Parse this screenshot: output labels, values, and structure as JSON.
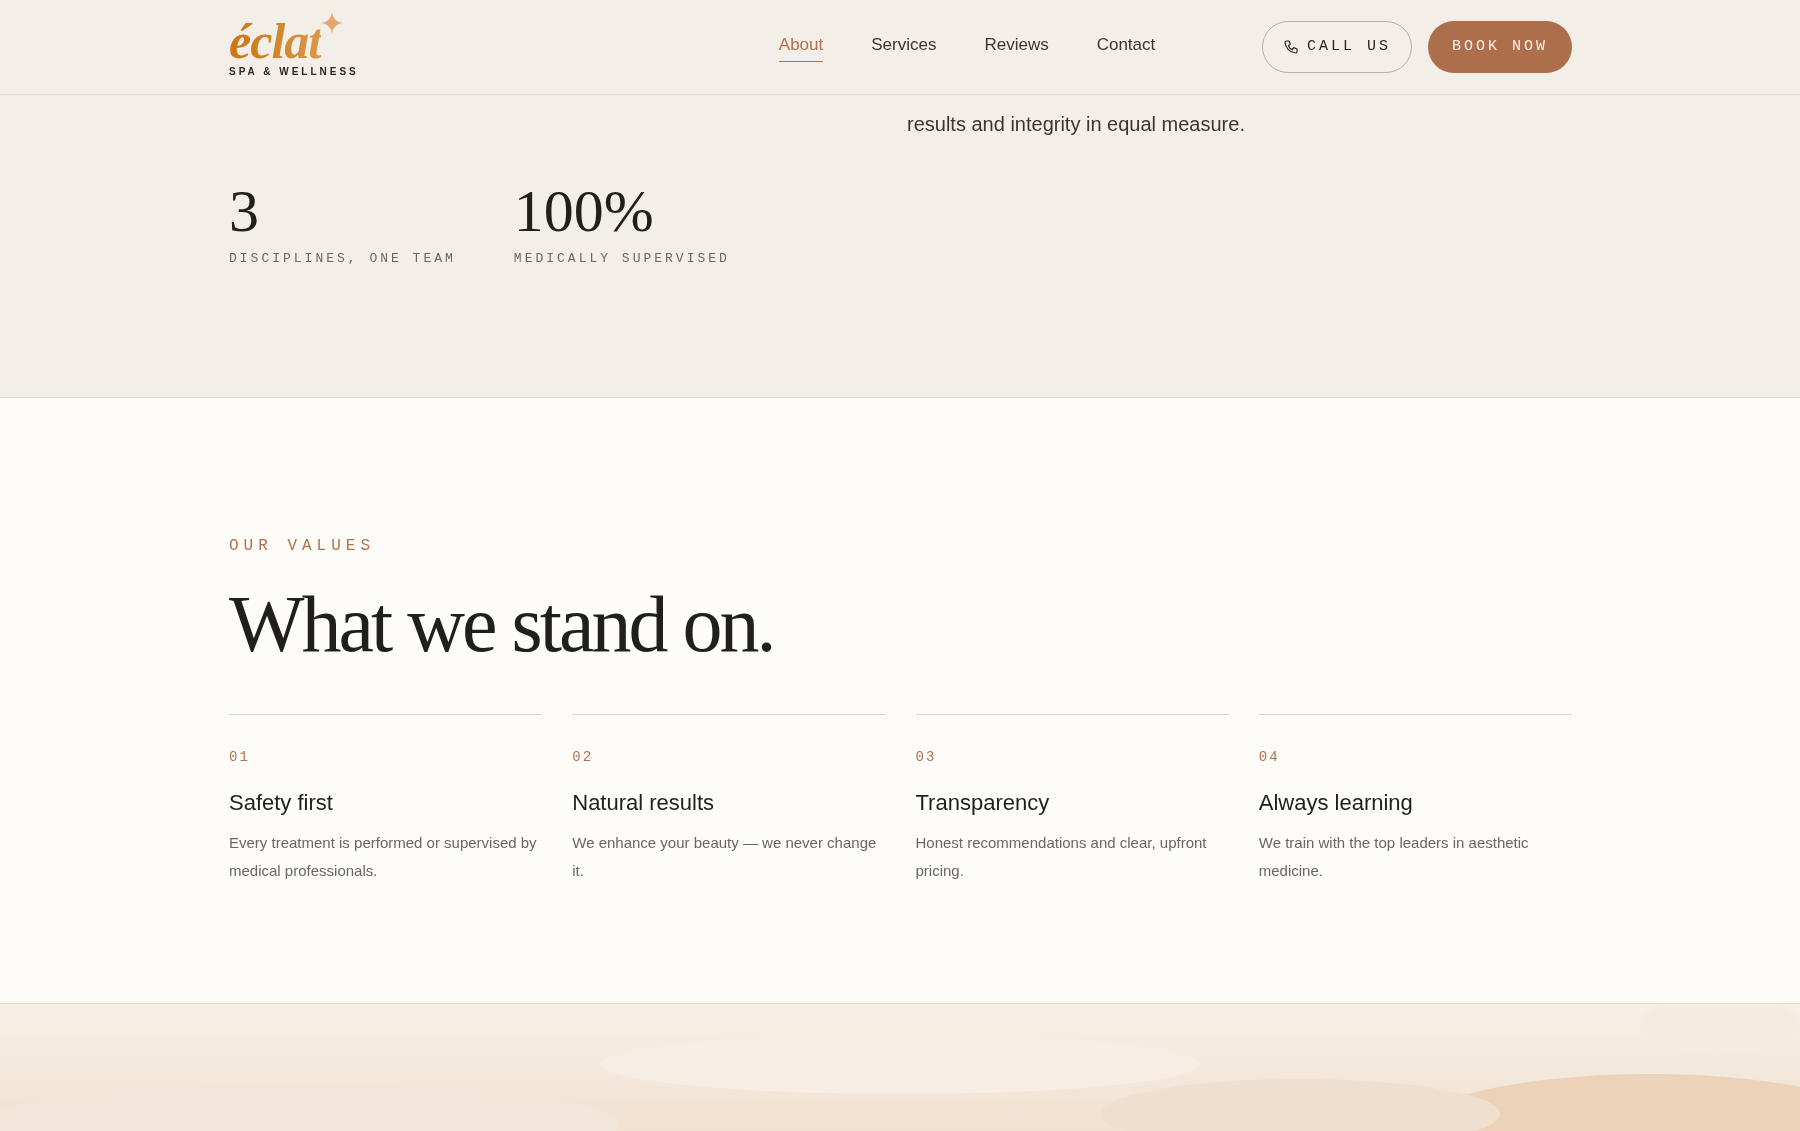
{
  "header": {
    "logo": {
      "name": "éclat",
      "tagline": "SPA & WELLNESS"
    },
    "nav": [
      {
        "label": "About",
        "selected": true
      },
      {
        "label": "Services",
        "selected": false
      },
      {
        "label": "Reviews",
        "selected": false
      },
      {
        "label": "Contact",
        "selected": false
      }
    ],
    "call_button": "CALL US",
    "book_button": "BOOK NOW"
  },
  "intro": {
    "paragraph_end": "results and integrity in equal measure.",
    "stats": [
      {
        "value": "3",
        "label": "DISCIPLINES, ONE TEAM"
      },
      {
        "value": "100%",
        "label": "MEDICALLY SUPERVISED"
      }
    ]
  },
  "values": {
    "eyebrow": "OUR VALUES",
    "heading": "What we stand on.",
    "items": [
      {
        "number": "01",
        "title": "Safety first",
        "text": "Every treatment is performed or supervised by medical professionals."
      },
      {
        "number": "02",
        "title": "Natural results",
        "text": "We enhance your beauty — we never change it."
      },
      {
        "number": "03",
        "title": "Transparency",
        "text": "Honest recommendations and clear, upfront pricing."
      },
      {
        "number": "04",
        "title": "Always learning",
        "text": "We train with the top leaders in aesthetic medicine."
      }
    ]
  }
}
